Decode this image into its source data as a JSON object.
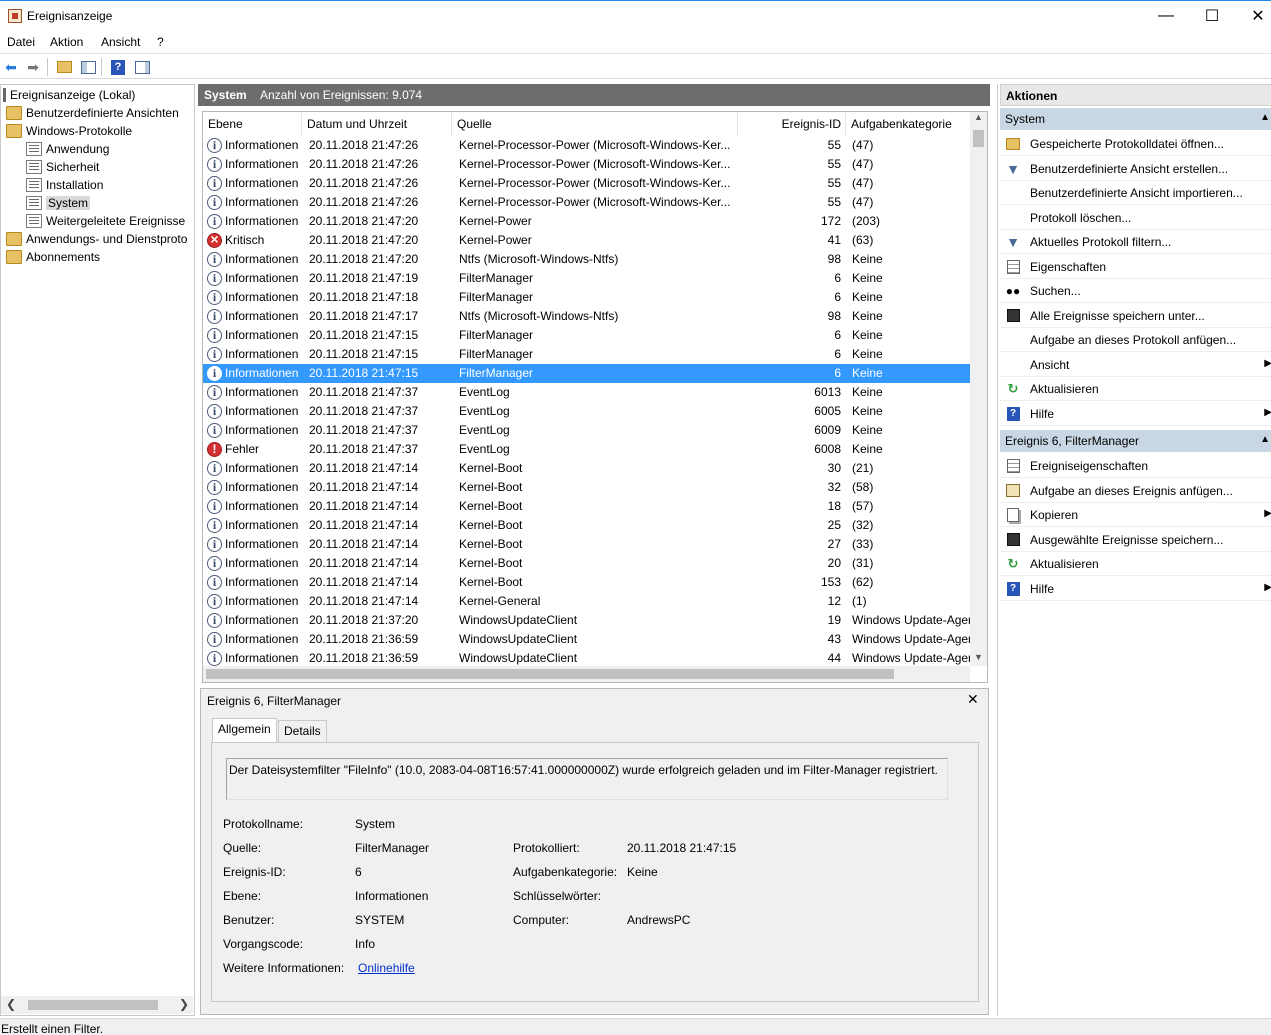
{
  "window": {
    "title": "Ereignisanzeige",
    "minimize": "—",
    "maximize": "☐",
    "close": "✕"
  },
  "menu": [
    "Datei",
    "Aktion",
    "Ansicht",
    "?"
  ],
  "tree": {
    "root": "Ereignisanzeige (Lokal)",
    "custom_views": "Benutzerdefinierte Ansichten",
    "windows_logs": "Windows-Protokolle",
    "logs": [
      "Anwendung",
      "Sicherheit",
      "Installation",
      "System",
      "Weitergeleitete Ereignisse"
    ],
    "app_service_logs": "Anwendungs- und Dienstproto",
    "subscriptions": "Abonnements"
  },
  "events_panel": {
    "title": "System",
    "count": "Anzahl von Ereignissen: 9.074"
  },
  "columns": {
    "level": "Ebene",
    "date": "Datum und Uhrzeit",
    "source": "Quelle",
    "id": "Ereignis-ID",
    "category": "Aufgabenkategorie"
  },
  "events": [
    {
      "type": "info",
      "level": "Informationen",
      "date": "20.11.2018 21:47:26",
      "source": "Kernel-Processor-Power (Microsoft-Windows-Ker...",
      "id": "55",
      "category": "(47)"
    },
    {
      "type": "info",
      "level": "Informationen",
      "date": "20.11.2018 21:47:26",
      "source": "Kernel-Processor-Power (Microsoft-Windows-Ker...",
      "id": "55",
      "category": "(47)"
    },
    {
      "type": "info",
      "level": "Informationen",
      "date": "20.11.2018 21:47:26",
      "source": "Kernel-Processor-Power (Microsoft-Windows-Ker...",
      "id": "55",
      "category": "(47)"
    },
    {
      "type": "info",
      "level": "Informationen",
      "date": "20.11.2018 21:47:26",
      "source": "Kernel-Processor-Power (Microsoft-Windows-Ker...",
      "id": "55",
      "category": "(47)"
    },
    {
      "type": "info",
      "level": "Informationen",
      "date": "20.11.2018 21:47:20",
      "source": "Kernel-Power",
      "id": "172",
      "category": "(203)"
    },
    {
      "type": "critical",
      "level": "Kritisch",
      "date": "20.11.2018 21:47:20",
      "source": "Kernel-Power",
      "id": "41",
      "category": "(63)"
    },
    {
      "type": "info",
      "level": "Informationen",
      "date": "20.11.2018 21:47:20",
      "source": "Ntfs (Microsoft-Windows-Ntfs)",
      "id": "98",
      "category": "Keine"
    },
    {
      "type": "info",
      "level": "Informationen",
      "date": "20.11.2018 21:47:19",
      "source": "FilterManager",
      "id": "6",
      "category": "Keine"
    },
    {
      "type": "info",
      "level": "Informationen",
      "date": "20.11.2018 21:47:18",
      "source": "FilterManager",
      "id": "6",
      "category": "Keine"
    },
    {
      "type": "info",
      "level": "Informationen",
      "date": "20.11.2018 21:47:17",
      "source": "Ntfs (Microsoft-Windows-Ntfs)",
      "id": "98",
      "category": "Keine"
    },
    {
      "type": "info",
      "level": "Informationen",
      "date": "20.11.2018 21:47:15",
      "source": "FilterManager",
      "id": "6",
      "category": "Keine"
    },
    {
      "type": "info",
      "level": "Informationen",
      "date": "20.11.2018 21:47:15",
      "source": "FilterManager",
      "id": "6",
      "category": "Keine"
    },
    {
      "type": "info",
      "level": "Informationen",
      "date": "20.11.2018 21:47:15",
      "source": "FilterManager",
      "id": "6",
      "category": "Keine",
      "selected": true
    },
    {
      "type": "info",
      "level": "Informationen",
      "date": "20.11.2018 21:47:37",
      "source": "EventLog",
      "id": "6013",
      "category": "Keine"
    },
    {
      "type": "info",
      "level": "Informationen",
      "date": "20.11.2018 21:47:37",
      "source": "EventLog",
      "id": "6005",
      "category": "Keine"
    },
    {
      "type": "info",
      "level": "Informationen",
      "date": "20.11.2018 21:47:37",
      "source": "EventLog",
      "id": "6009",
      "category": "Keine"
    },
    {
      "type": "error",
      "level": "Fehler",
      "date": "20.11.2018 21:47:37",
      "source": "EventLog",
      "id": "6008",
      "category": "Keine"
    },
    {
      "type": "info",
      "level": "Informationen",
      "date": "20.11.2018 21:47:14",
      "source": "Kernel-Boot",
      "id": "30",
      "category": "(21)"
    },
    {
      "type": "info",
      "level": "Informationen",
      "date": "20.11.2018 21:47:14",
      "source": "Kernel-Boot",
      "id": "32",
      "category": "(58)"
    },
    {
      "type": "info",
      "level": "Informationen",
      "date": "20.11.2018 21:47:14",
      "source": "Kernel-Boot",
      "id": "18",
      "category": "(57)"
    },
    {
      "type": "info",
      "level": "Informationen",
      "date": "20.11.2018 21:47:14",
      "source": "Kernel-Boot",
      "id": "25",
      "category": "(32)"
    },
    {
      "type": "info",
      "level": "Informationen",
      "date": "20.11.2018 21:47:14",
      "source": "Kernel-Boot",
      "id": "27",
      "category": "(33)"
    },
    {
      "type": "info",
      "level": "Informationen",
      "date": "20.11.2018 21:47:14",
      "source": "Kernel-Boot",
      "id": "20",
      "category": "(31)"
    },
    {
      "type": "info",
      "level": "Informationen",
      "date": "20.11.2018 21:47:14",
      "source": "Kernel-Boot",
      "id": "153",
      "category": "(62)"
    },
    {
      "type": "info",
      "level": "Informationen",
      "date": "20.11.2018 21:47:14",
      "source": "Kernel-General",
      "id": "12",
      "category": "(1)"
    },
    {
      "type": "info",
      "level": "Informationen",
      "date": "20.11.2018 21:37:20",
      "source": "WindowsUpdateClient",
      "id": "19",
      "category": "Windows Update-Ager"
    },
    {
      "type": "info",
      "level": "Informationen",
      "date": "20.11.2018 21:36:59",
      "source": "WindowsUpdateClient",
      "id": "43",
      "category": "Windows Update-Ager"
    },
    {
      "type": "info",
      "level": "Informationen",
      "date": "20.11.2018 21:36:59",
      "source": "WindowsUpdateClient",
      "id": "44",
      "category": "Windows Update-Ager"
    }
  ],
  "detail": {
    "title": "Ereignis 6, FilterManager",
    "tabs": [
      "Allgemein",
      "Details"
    ],
    "message": "Der Dateisystemfilter \"FileInfo\" (10.0, 2083-04-08T16:57:41.000000000Z) wurde erfolgreich geladen und im Filter-Manager registriert.",
    "labels": {
      "log_name": "Protokollname:",
      "source": "Quelle:",
      "event_id": "Ereignis-ID:",
      "level": "Ebene:",
      "user": "Benutzer:",
      "opcode": "Vorgangscode:",
      "more_info": "Weitere Informationen:",
      "logged": "Protokolliert:",
      "task_category": "Aufgabenkategorie:",
      "keywords": "Schlüsselwörter:",
      "computer": "Computer:"
    },
    "values": {
      "log_name": "System",
      "source": "FilterManager",
      "event_id": "6",
      "level": "Informationen",
      "user": "SYSTEM",
      "opcode": "Info",
      "more_info": "Onlinehilfe",
      "logged": "20.11.2018 21:47:15",
      "task_category": "Keine",
      "keywords": "",
      "computer": "AndrewsPC"
    }
  },
  "actions": {
    "header": "Aktionen",
    "section1": "System",
    "items1": [
      {
        "label": "Gespeicherte Protokolldatei öffnen...",
        "icon": "open-log-icon"
      },
      {
        "label": "Benutzerdefinierte Ansicht erstellen...",
        "icon": "filter-icon"
      },
      {
        "label": "Benutzerdefinierte Ansicht importieren...",
        "icon": ""
      },
      {
        "label": "Protokoll löschen...",
        "icon": ""
      },
      {
        "label": "Aktuelles Protokoll filtern...",
        "icon": "filter-icon"
      },
      {
        "label": "Eigenschaften",
        "icon": "properties-icon"
      },
      {
        "label": "Suchen...",
        "icon": "binoculars-icon"
      },
      {
        "label": "Alle Ereignisse speichern unter...",
        "icon": "save-icon"
      },
      {
        "label": "Aufgabe an dieses Protokoll anfügen...",
        "icon": ""
      },
      {
        "label": "Ansicht",
        "icon": "",
        "submenu": true
      },
      {
        "label": "Aktualisieren",
        "icon": "refresh-icon"
      },
      {
        "label": "Hilfe",
        "icon": "help-icon",
        "submenu": true
      }
    ],
    "section2": "Ereignis 6, FilterManager",
    "items2": [
      {
        "label": "Ereigniseigenschaften",
        "icon": "properties-icon"
      },
      {
        "label": "Aufgabe an dieses Ereignis anfügen...",
        "icon": "task-icon"
      },
      {
        "label": "Kopieren",
        "icon": "copy-icon",
        "submenu": true
      },
      {
        "label": "Ausgewählte Ereignisse speichern...",
        "icon": "save-icon"
      },
      {
        "label": "Aktualisieren",
        "icon": "refresh-icon"
      },
      {
        "label": "Hilfe",
        "icon": "help-icon",
        "submenu": true
      }
    ]
  },
  "status": "Erstellt einen Filter.",
  "colors": {
    "selection": "#3399ff",
    "header_dark": "#6d6d6d",
    "section_blue": "#c9d7e5",
    "link": "#0033cc"
  }
}
